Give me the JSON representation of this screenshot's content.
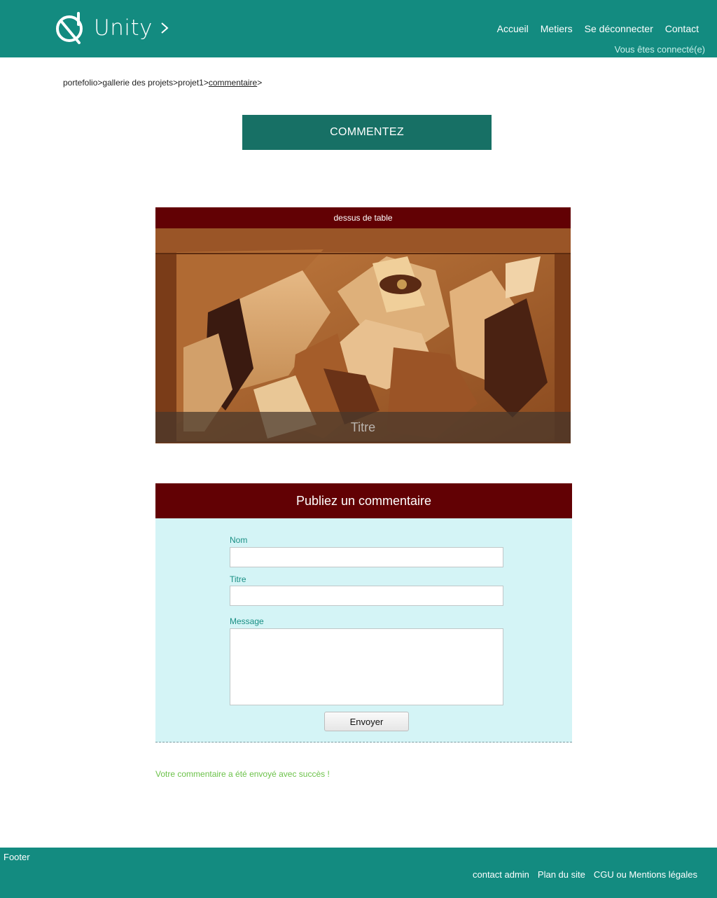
{
  "header": {
    "logo_text": "Unity",
    "nav": [
      "Accueil",
      "Metiers",
      "Se déconnecter",
      "Contact"
    ],
    "status": "Vous êtes connecté(e)"
  },
  "breadcrumb": [
    "portefolio",
    "gallerie des projets",
    "projet1",
    "commentaire"
  ],
  "breadcrumb_sep": ">",
  "cta_label": "COMMENTEZ",
  "project": {
    "header": "dessus de table",
    "caption": "Titre"
  },
  "form": {
    "title": "Publiez un commentaire",
    "name_label": "Nom",
    "title_label": "Titre",
    "message_label": "Message",
    "submit_label": "Envoyer"
  },
  "success_message": "Votre commentaire a été envoyé avec succès !",
  "footer": {
    "label": "Footer",
    "links": [
      "contact admin",
      "Plan du site",
      "CGU ou Mentions légales"
    ]
  },
  "colors": {
    "primary": "#138b80",
    "cta": "#177065",
    "dark_red": "#620104",
    "form_bg": "#d4f4f6",
    "success": "#6cc24a"
  }
}
